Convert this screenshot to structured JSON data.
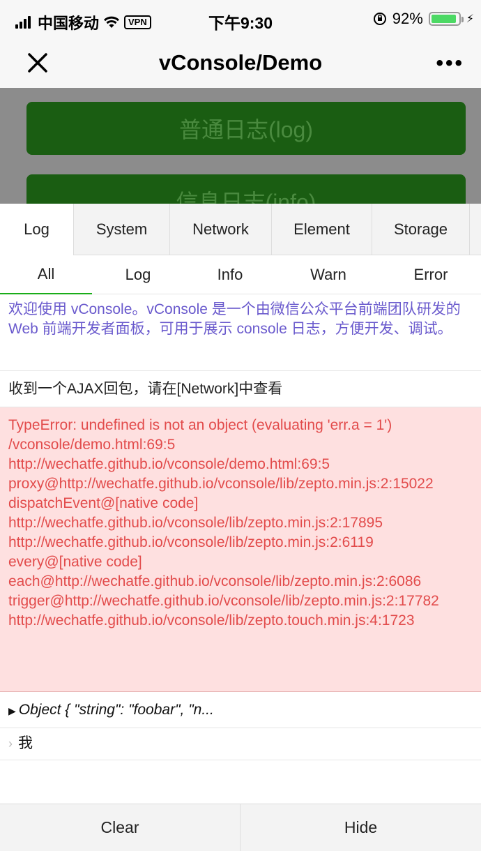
{
  "status_bar": {
    "carrier": "中国移动",
    "vpn": "VPN",
    "time": "下午9:30",
    "battery_percent": "92%",
    "battery_level": 0.92
  },
  "nav": {
    "title": "vConsole/Demo",
    "more": "•••"
  },
  "demo_buttons": [
    "普通日志(log)",
    "信息日志(info)"
  ],
  "vconsole": {
    "tabs": [
      "Log",
      "System",
      "Network",
      "Element",
      "Storage"
    ],
    "subtabs": [
      "All",
      "Log",
      "Info",
      "Warn",
      "Error"
    ],
    "logs": {
      "info": "欢迎使用 vConsole。vConsole 是一个由微信公众平台前端团队研发的 Web 前端开发者面板，可用于展示 console 日志，方便开发、调试。",
      "plain": "收到一个AJAX回包，请在[Network]中查看",
      "error_lines": [
        "TypeError: undefined is not an object (evaluating 'err.a = 1')",
        "/vconsole/demo.html:69:5",
        "http://wechatfe.github.io/vconsole/demo.html:69:5",
        "proxy@http://wechatfe.github.io/vconsole/lib/zepto.min.js:2:15022",
        "dispatchEvent@[native code]",
        "http://wechatfe.github.io/vconsole/lib/zepto.min.js:2:17895",
        "http://wechatfe.github.io/vconsole/lib/zepto.min.js:2:6119",
        "every@[native code]",
        "each@http://wechatfe.github.io/vconsole/lib/zepto.min.js:2:6086",
        "trigger@http://wechatfe.github.io/vconsole/lib/zepto.min.js:2:17782",
        "http://wechatfe.github.io/vconsole/lib/zepto.touch.min.js:4:1723"
      ],
      "object": "Object { \"string\": \"foobar\", \"n...",
      "command": "我"
    },
    "bottom": {
      "clear": "Clear",
      "hide": "Hide"
    }
  },
  "colors": {
    "info": "#6a5acd",
    "error_text": "#e24b4b",
    "error_bg": "#fee0e0",
    "demo_button": "#1a5d12"
  }
}
